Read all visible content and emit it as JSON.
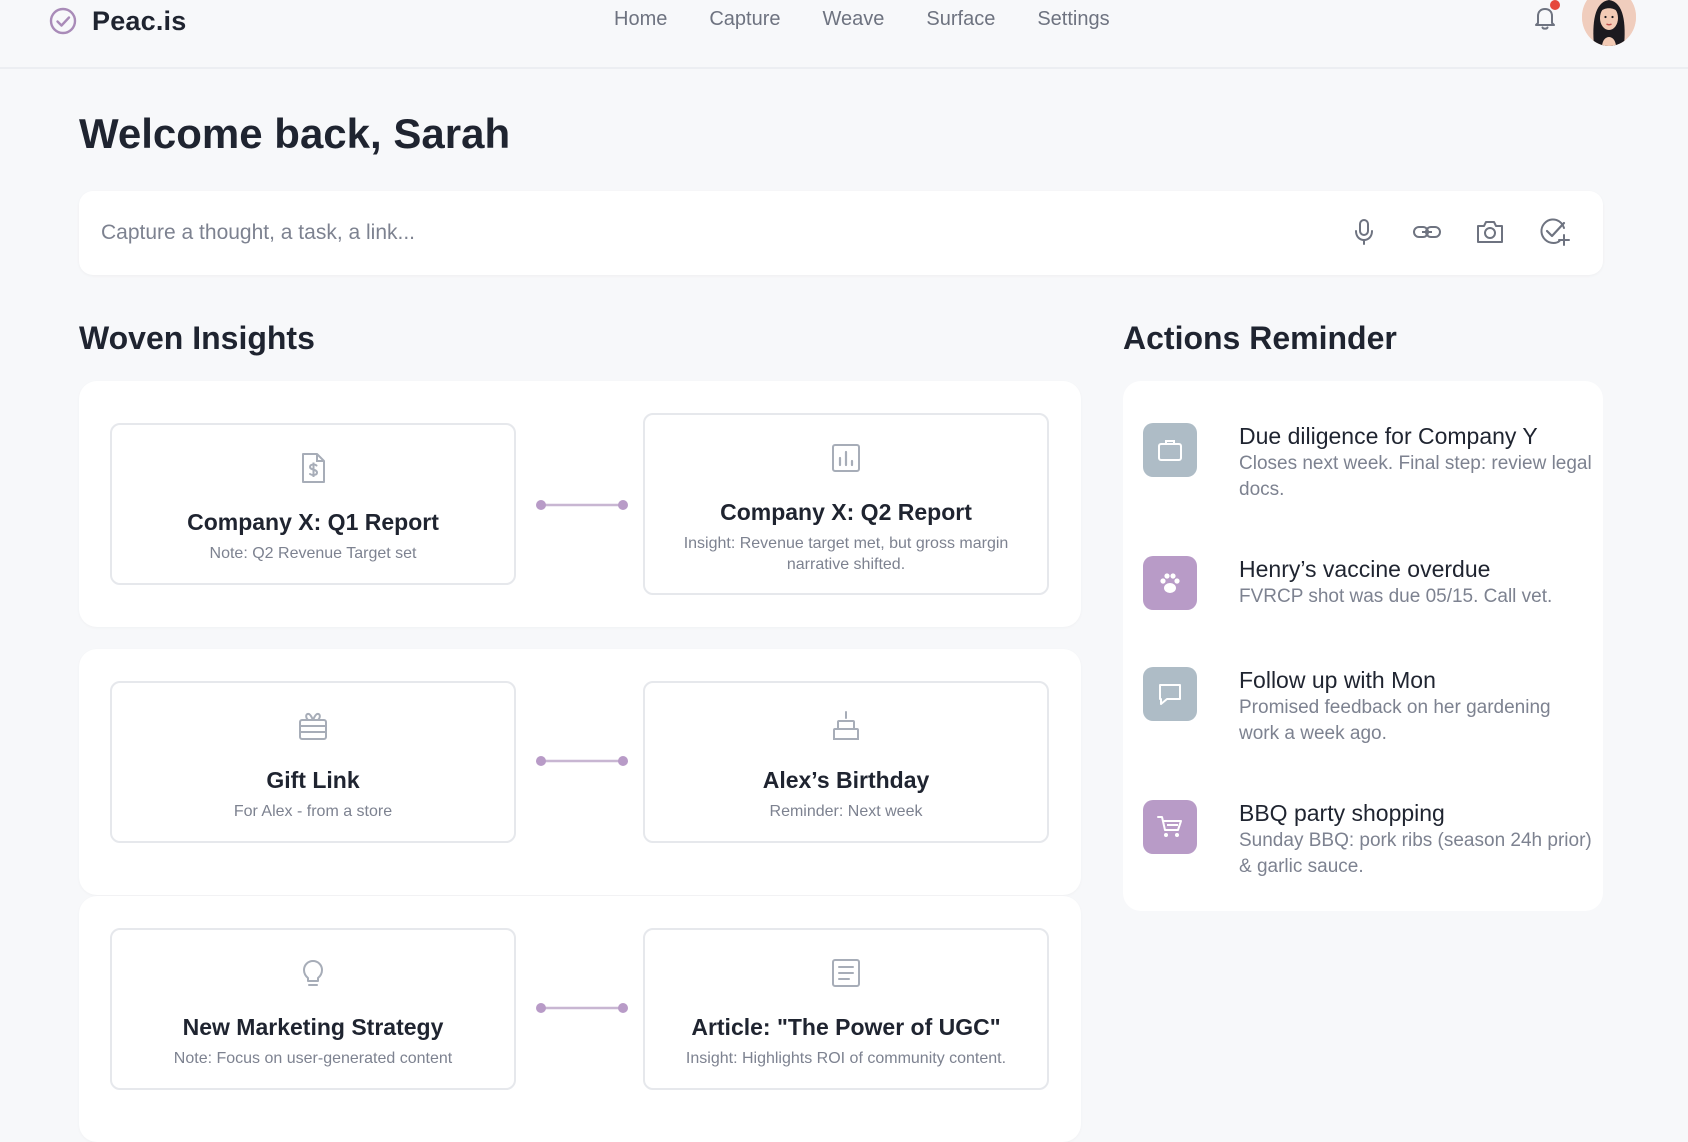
{
  "brand": {
    "name": "Peac.is",
    "icon": "check-circle-icon",
    "accent": "#a98bb8"
  },
  "nav": [
    "Home",
    "Capture",
    "Weave",
    "Surface",
    "Settings"
  ],
  "header": {
    "notification_icon": "bell-icon",
    "notification_dot_color": "#e5483b",
    "avatar": "user-avatar"
  },
  "welcome": "Welcome back, Sarah",
  "capture": {
    "placeholder": "Capture a thought, a task, a link...",
    "actions": [
      "microphone-icon",
      "link-icon",
      "camera-icon",
      "check-plus-icon"
    ]
  },
  "insights": {
    "title": "Woven Insights",
    "pairs": [
      {
        "left": {
          "icon": "dollar-document-icon",
          "title": "Company X: Q1 Report",
          "sub": "Note: Q2 Revenue Target set"
        },
        "right": {
          "icon": "bar-chart-icon",
          "title": "Company X: Q2 Report",
          "sub": "Insight: Revenue target met, but gross margin narrative shifted."
        }
      },
      {
        "left": {
          "icon": "gift-icon",
          "title": "Gift Link",
          "sub": "For Alex - from a store"
        },
        "right": {
          "icon": "cake-icon",
          "title": "Alex’s Birthday",
          "sub": "Reminder: Next week"
        }
      },
      {
        "left": {
          "icon": "lightbulb-icon",
          "title": "New Marketing Strategy",
          "sub": "Note: Focus on user-generated content"
        },
        "right": {
          "icon": "article-icon",
          "title": "Article: \"The Power of UGC\"",
          "sub": "Insight: Highlights ROI of community content."
        }
      }
    ]
  },
  "actions": {
    "title": "Actions Reminder",
    "items": [
      {
        "icon": "briefcase-icon",
        "color": "#aebcc6",
        "title": "Due diligence for Company Y",
        "sub": "Closes next week. Final step: review legal docs."
      },
      {
        "icon": "paw-icon",
        "color": "#b89bc7",
        "title": "Henry’s vaccine overdue",
        "sub": "FVRCP shot was due 05/15. Call vet."
      },
      {
        "icon": "chat-icon",
        "color": "#aebcc6",
        "title": "Follow up with Mon",
        "sub": "Promised feedback on her gardening work a week ago."
      },
      {
        "icon": "cart-icon",
        "color": "#b89bc7",
        "title": "BBQ party shopping",
        "sub": "Sunday BBQ: pork ribs (season 24h prior) & garlic sauce."
      }
    ]
  },
  "colors": {
    "icon_gray": "#a7adb8",
    "connector": "#b89bc7"
  }
}
